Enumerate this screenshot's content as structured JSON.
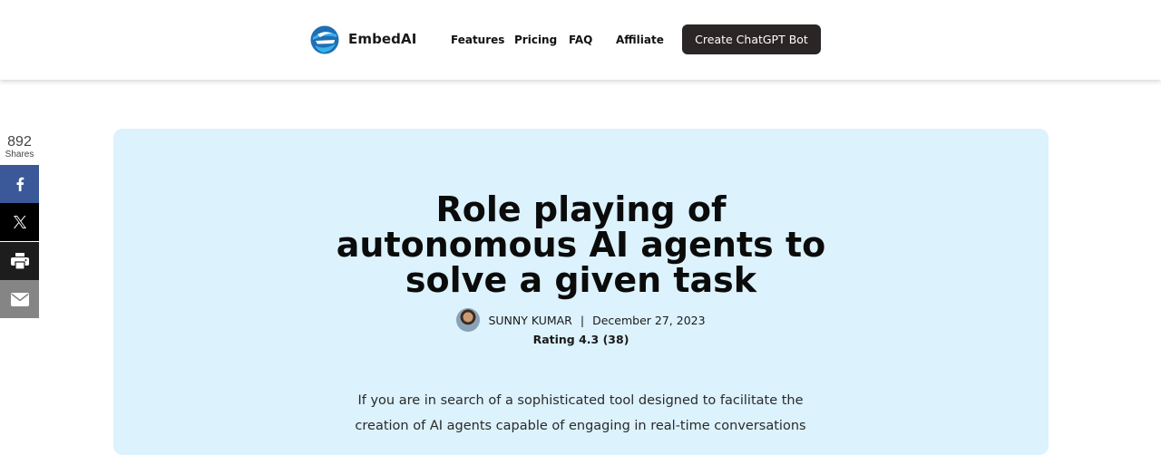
{
  "header": {
    "brand": "EmbedAI",
    "nav": [
      "Features",
      "Pricing",
      "FAQ",
      "Affiliate"
    ],
    "cta_label": "Create ChatGPT Bot",
    "logo_colors": [
      "#1f6fb5",
      "#35b3e8"
    ]
  },
  "share": {
    "count": "892",
    "label": "Shares",
    "buttons": [
      {
        "name": "facebook",
        "icon": "facebook-icon",
        "color": "#3b5998"
      },
      {
        "name": "x",
        "icon": "x-icon",
        "color": "#000000"
      },
      {
        "name": "print",
        "icon": "print-icon",
        "color": "#1d1d1d"
      },
      {
        "name": "email",
        "icon": "email-icon",
        "color": "#858585"
      }
    ]
  },
  "article": {
    "title_lines": [
      "Role playing of",
      "autonomous AI agents to",
      "solve a given task"
    ],
    "author": "SUNNY KUMAR",
    "separator": "|",
    "date": "December 27, 2023",
    "rating": "Rating 4.3 (38)",
    "intro": "If you are in search of a sophisticated tool designed to facilitate the creation of AI agents capable of engaging in real-time conversations",
    "hero_bg": "#dcf2fc"
  }
}
